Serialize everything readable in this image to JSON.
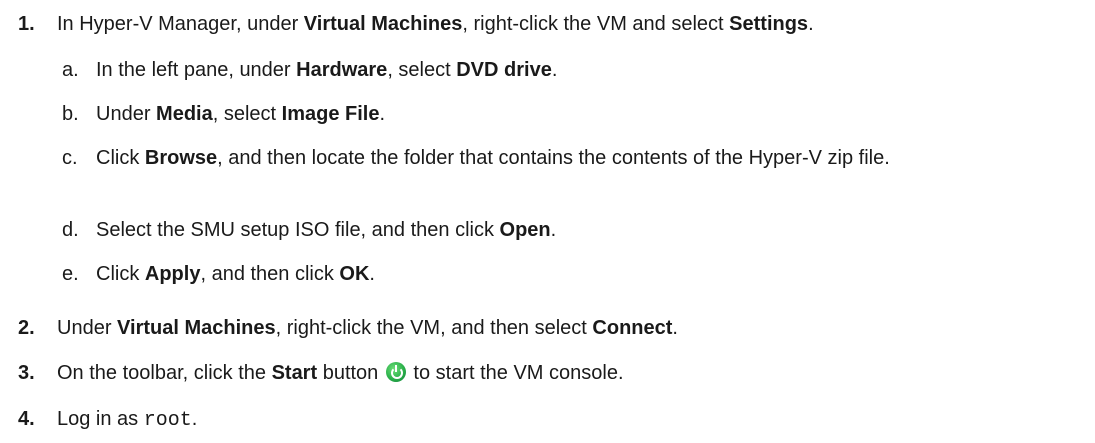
{
  "steps": [
    {
      "number": "1.",
      "parts": {
        "t1": "In Hyper-V Manager, under ",
        "b1": "Virtual Machines",
        "t2": ", right-click the VM and select ",
        "b2": "Settings",
        "t3": "."
      },
      "substeps": [
        {
          "letter": "a.",
          "t1": "In the left pane, under ",
          "b1": "Hardware",
          "t2": ", select ",
          "b2": "DVD drive",
          "t3": "."
        },
        {
          "letter": "b.",
          "t1": "Under ",
          "b1": "Media",
          "t2": ", select ",
          "b2": "Image File",
          "t3": "."
        },
        {
          "letter": "c.",
          "t1": "Click ",
          "b1": "Browse",
          "t2": ", and then locate the folder that contains the contents of the Hyper-V zip file."
        },
        {
          "letter": "d.",
          "t1": "Select the SMU setup ISO file, and then click ",
          "b1": "Open",
          "t2": "."
        },
        {
          "letter": "e.",
          "t1": "Click ",
          "b1": "Apply",
          "t2": ", and then click ",
          "b2": "OK",
          "t3": "."
        }
      ]
    },
    {
      "number": "2.",
      "parts": {
        "t1": "Under ",
        "b1": "Virtual Machines",
        "t2": ", right-click the VM, and then select ",
        "b2": "Connect",
        "t3": "."
      }
    },
    {
      "number": "3.",
      "parts": {
        "t1": "On the toolbar, click the ",
        "b1": "Start",
        "t2": " button ",
        "icon": "start-power-icon",
        "t3": " to start the VM console."
      }
    },
    {
      "number": "4.",
      "parts": {
        "t1": "Log in as ",
        "code": "root",
        "t2": "."
      }
    }
  ]
}
